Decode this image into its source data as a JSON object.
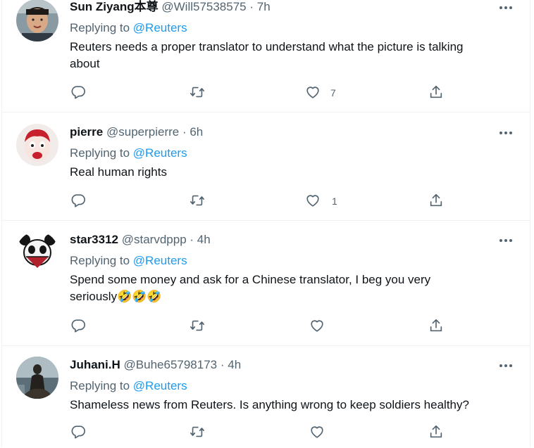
{
  "tweets": [
    {
      "name": "Sun Ziyang本尊",
      "handle": "@Will57538575",
      "time": "7h",
      "replying_prefix": "Replying to",
      "replying_to": "@Reuters",
      "text_lines": [
        "Reuters needs a proper translator to understand what the picture is talking",
        "about"
      ],
      "like_count": "7",
      "icons": [
        "reply-icon",
        "retweet-icon",
        "like-icon",
        "share-icon",
        "more-icon"
      ]
    },
    {
      "name": "pierre",
      "handle": "@superpierre",
      "time": "6h",
      "replying_prefix": "Replying to",
      "replying_to": "@Reuters",
      "text_lines": [
        "Real human rights"
      ],
      "like_count": "1",
      "icons": [
        "reply-icon",
        "retweet-icon",
        "like-icon",
        "share-icon",
        "more-icon"
      ]
    },
    {
      "name": "star3312",
      "handle": "@starvdppp",
      "time": "4h",
      "replying_prefix": "Replying to",
      "replying_to": "@Reuters",
      "text_lines": [
        "Spend some money and ask for a Chinese translator, I beg you very",
        "seriously🤣🤣🤣"
      ],
      "like_count": "",
      "icons": [
        "reply-icon",
        "retweet-icon",
        "like-icon",
        "share-icon",
        "more-icon"
      ]
    },
    {
      "name": "Juhani.H",
      "handle": "@Buhe65798173",
      "time": "4h",
      "replying_prefix": "Replying to",
      "replying_to": "@Reuters",
      "text_lines": [
        "Shameless news from Reuters. Is anything wrong to keep soldiers healthy?"
      ],
      "like_count": "",
      "icons": [
        "reply-icon",
        "retweet-icon",
        "like-icon",
        "share-icon",
        "more-icon"
      ]
    }
  ],
  "separator": " · ",
  "colors": {
    "link": "#1d9bf0",
    "secondary": "#536471",
    "text": "#0f1419",
    "border": "#eff3f4"
  }
}
